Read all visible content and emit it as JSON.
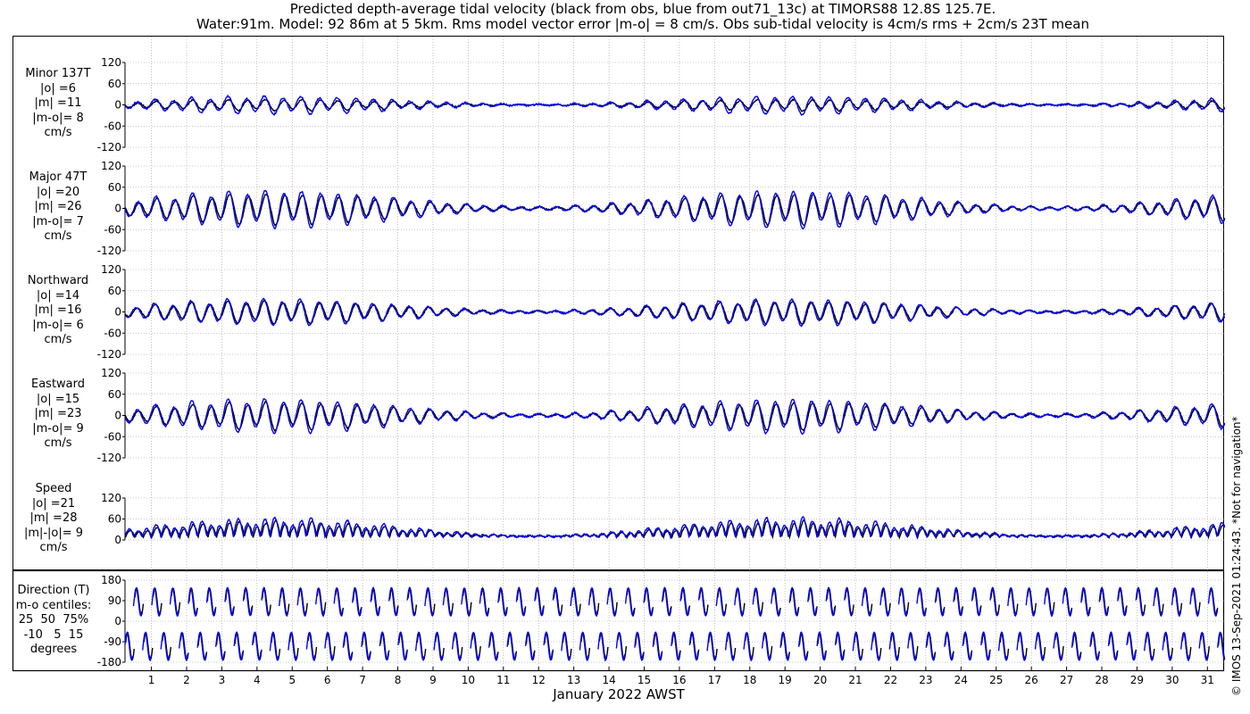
{
  "titles": {
    "line1": "Predicted depth-average tidal velocity (black from obs, blue from out71_13c) at TIMORS88 12.8S 125.7E.",
    "line2": "Water:91m. Model: 92 86m at 5 5km. Rms model vector error |m-o| = 8 cm/s. Obs sub-tidal velocity is 4cm/s rms + 2cm/s 23T mean"
  },
  "credit": "© IMOS 13-Sep-2021 01:24:43. *Not for navigation*",
  "colors": {
    "obs": "#000000",
    "model": "#0000ff",
    "grid": "#999999"
  },
  "chart_data": {
    "type": "line",
    "xlabel": "January 2022 AWST",
    "x_range": [
      0.25,
      31.5
    ],
    "x_ticks": [
      "1",
      "2",
      "3",
      "4",
      "5",
      "6",
      "7",
      "8",
      "9",
      "10",
      "11",
      "12",
      "13",
      "14",
      "15",
      "16",
      "17",
      "18",
      "19",
      "20",
      "21",
      "22",
      "23",
      "24",
      "25",
      "26",
      "27",
      "28",
      "29",
      "30",
      "31"
    ],
    "series_names": [
      "obs",
      "model"
    ],
    "panels": [
      {
        "label": "Minor 137T\n|o| =6\n|m| =11\n|m-o|= 8\ncm/s",
        "ylim": [
          -120,
          120
        ],
        "yticks": [
          "120",
          "60",
          "0",
          "-60",
          "-120"
        ],
        "obs_amp": 14,
        "model_amp": 22,
        "kind": "vel",
        "phase": 0.3
      },
      {
        "label": "Major 47T\n|o| =20\n|m| =26\n|m-o|= 7\ncm/s",
        "ylim": [
          -120,
          120
        ],
        "yticks": [
          "120",
          "60",
          "0",
          "-60",
          "-120"
        ],
        "obs_amp": 38,
        "model_amp": 46,
        "kind": "vel",
        "phase": 0.0
      },
      {
        "label": "Northward\n|o| =14\n|m| =16\n|m-o|= 6\ncm/s",
        "ylim": [
          -120,
          120
        ],
        "yticks": [
          "120",
          "60",
          "0",
          "-60",
          "-120"
        ],
        "obs_amp": 28,
        "model_amp": 32,
        "kind": "vel",
        "phase": 0.6
      },
      {
        "label": "Eastward\n|o| =15\n|m| =23\n|m-o|= 9\ncm/s",
        "ylim": [
          -120,
          120
        ],
        "yticks": [
          "120",
          "60",
          "0",
          "-60",
          "-120"
        ],
        "obs_amp": 34,
        "model_amp": 42,
        "kind": "vel",
        "phase": 0.2
      },
      {
        "label": "Speed\n|o| =21\n|m| =28\n|m|-|o|= 9\ncm/s",
        "ylim": [
          0,
          120
        ],
        "yticks": [
          "120",
          "60",
          "0"
        ],
        "obs_amp": 38,
        "model_amp": 46,
        "kind": "speed",
        "phase": 0.0
      },
      {
        "label": "Direction (T)\nm-o centiles:\n25  50  75%\n-10   5  15\ndegrees",
        "ylim": [
          -180,
          180
        ],
        "yticks": [
          "180",
          "90",
          "0",
          "-90",
          "-180"
        ],
        "obs_amp": 180,
        "model_amp": 180,
        "kind": "dir",
        "phase": 0.0
      }
    ]
  }
}
